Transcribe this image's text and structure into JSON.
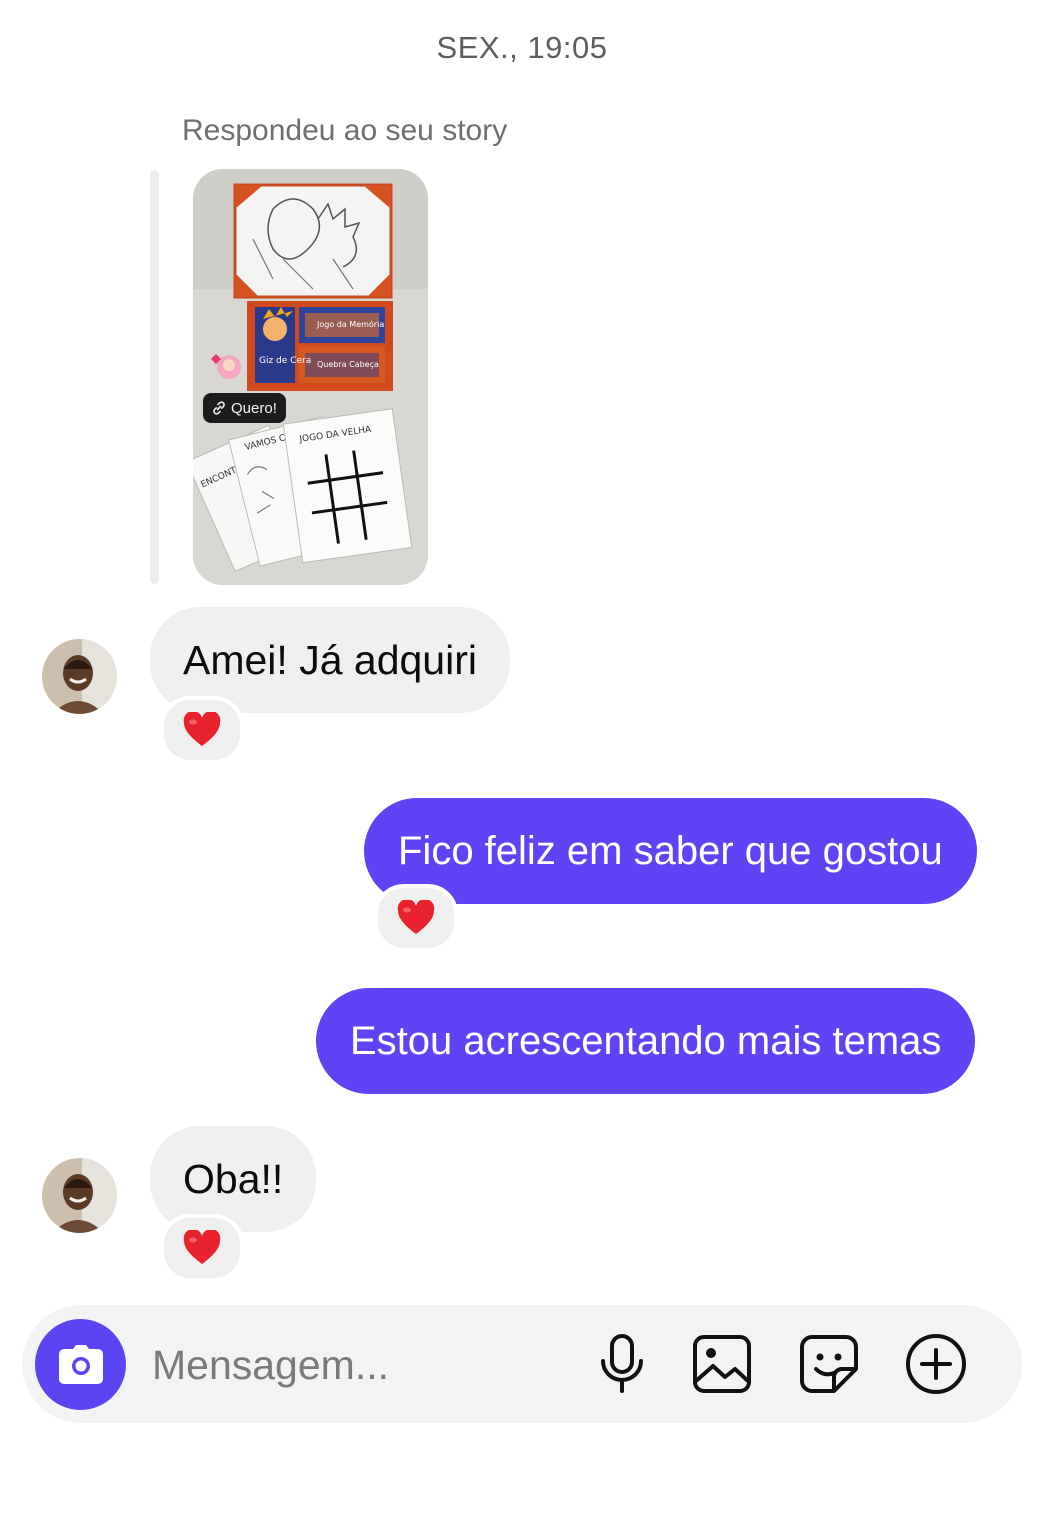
{
  "header": {
    "timestamp": "SEX., 19:05"
  },
  "story_reply": {
    "label": "Respondeu ao seu story",
    "link_sticker": "Quero!",
    "product_labels": [
      "Giz de Cera",
      "Jogo da Memória",
      "Quebra Cabeça"
    ],
    "sheet_titles": [
      "JOGO DA VELHA",
      "VAMOS CONTAR",
      "ENCONTRE"
    ]
  },
  "messages": [
    {
      "direction": "in",
      "text": "Amei! Já adquiri",
      "reaction": "❤️"
    },
    {
      "direction": "out",
      "text": "Fico feliz em saber que gostou",
      "reaction": "❤️"
    },
    {
      "direction": "out",
      "text": "Estou acrescentando mais temas"
    },
    {
      "direction": "in",
      "text": "Oba!!",
      "reaction": "❤️"
    }
  ],
  "composer": {
    "placeholder": "Mensagem...",
    "icons": [
      "camera-icon",
      "microphone-icon",
      "gallery-icon",
      "sticker-icon",
      "plus-circle-icon"
    ]
  },
  "colors": {
    "outgoing_bubble": "#6242f5",
    "incoming_bubble": "#efefef",
    "camera_button": "#5b45f3",
    "reaction_heart": "#e8232e"
  }
}
